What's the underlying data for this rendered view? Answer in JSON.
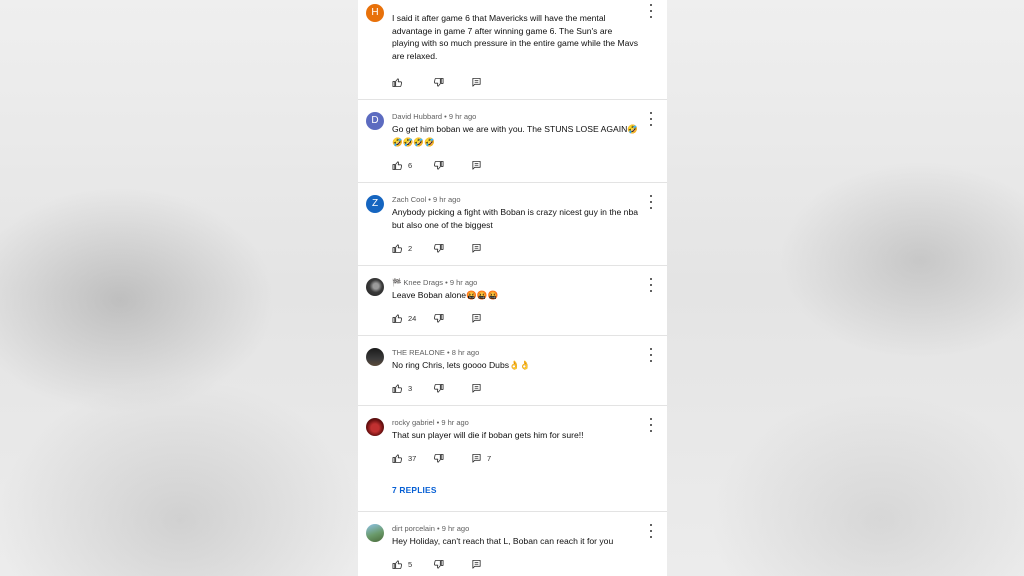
{
  "comments": [
    {
      "avatar_letter": "H",
      "avatar_color": "#e8710a",
      "text": "I said it after game 6 that Mavericks will have the mental advantage in game 7 after winning game 6. The Sun's are playing with so much pressure in the entire game while the Mavs are relaxed.",
      "likes": ""
    },
    {
      "author": "David Hubbard",
      "time": "9 hr ago",
      "avatar_letter": "D",
      "avatar_color": "#5c6bc0",
      "text": "Go get him boban we are with you. The STUNS LOSE   AGAIN🤣🤣🤣🤣🤣",
      "likes": "6"
    },
    {
      "author": "Zach Cool",
      "time": "9 hr ago",
      "avatar_letter": "Z",
      "avatar_color": "#1565c0",
      "text": "Anybody picking a fight with Boban is crazy nicest guy in the nba but also one of the biggest",
      "likes": "2"
    },
    {
      "author": "🏁 Knee Drags",
      "time": "9 hr ago",
      "avatar_color": "#3a3a3a",
      "text": "Leave Boban alone🤬🤬🤬",
      "likes": "24"
    },
    {
      "author": "THE REALONE",
      "time": "8 hr ago",
      "avatar_color": "#2a2a2a",
      "text": "No ring Chris, lets goooo Dubs👌👌",
      "likes": "3"
    },
    {
      "author": "rocky gabriel",
      "time": "9 hr ago",
      "avatar_color": "#8b1a1a",
      "text": "That sun player will die if boban gets him for sure!!",
      "likes": "37",
      "reply_count": "7",
      "replies_label": "7 REPLIES"
    },
    {
      "author": "dirt porcelain",
      "time": "9 hr ago",
      "avatar_color": "#6a9a6a",
      "text": "Hey Holiday, can't reach that L, Boban can reach it for you",
      "likes": "5"
    }
  ],
  "meta_separator": " • ",
  "colors": {
    "link_blue": "#065fd4",
    "text": "#0f0f0f",
    "secondary": "#606060"
  },
  "icons": [
    "thumbs-up-icon",
    "thumbs-down-icon",
    "reply-icon",
    "more-vert-icon"
  ]
}
